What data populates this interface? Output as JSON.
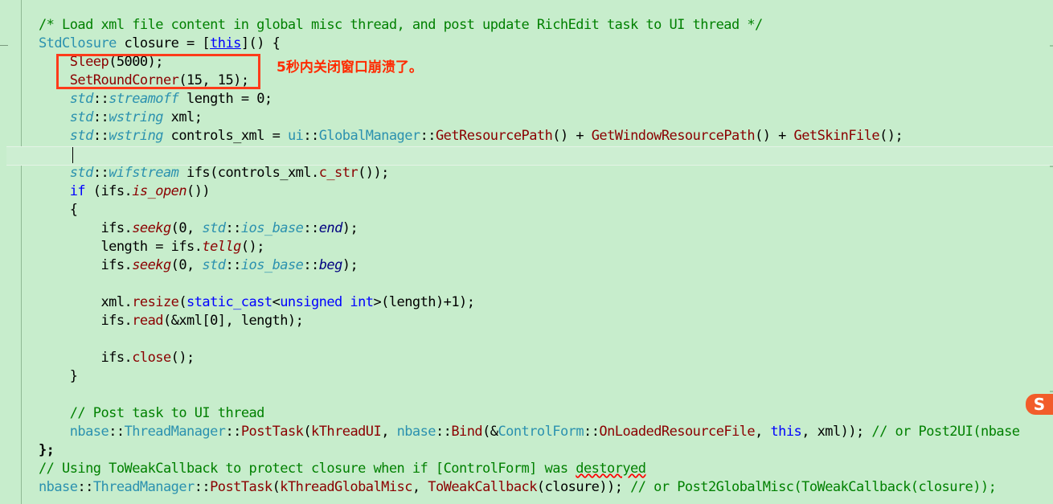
{
  "annotation": {
    "text": "5秒内关闭窗口崩溃了。",
    "color": "#ff2a00",
    "box_color": "#ff3b1a"
  },
  "editor": {
    "background": "#c7edcc",
    "lines": [
      "/* Load xml file content in global misc thread, and post update RichEdit task to UI thread */",
      "StdClosure closure = [this]() {",
      "Sleep(5000);",
      "SetRoundCorner(15, 15);",
      "std::streamoff length = 0;",
      "std::wstring xml;",
      "std::wstring controls_xml = ui::GlobalManager::GetResourcePath() + GetWindowResourcePath() + GetSkinFile();",
      "",
      "std::wifstream ifs(controls_xml.c_str());",
      "if (ifs.is_open())",
      "{",
      "ifs.seekg(0, std::ios_base::end);",
      "length = ifs.tellg();",
      "ifs.seekg(0, std::ios_base::beg);",
      "",
      "xml.resize(static_cast<unsigned int>(length)+1);",
      "ifs.read(&xml[0], length);",
      "",
      "ifs.close();",
      "}",
      "",
      "// Post task to UI thread",
      "nbase::ThreadManager::PostTask(kThreadUI, nbase::Bind(&ControlForm::OnLoadedResourceFile, this, xml)); // or Post2UI(nbase",
      "};",
      "// Using ToWeakCallback to protect closure when if [ControlForm] was destoryed",
      "nbase::ThreadManager::PostTask(kThreadGlobalMisc, ToWeakCallback(closure)); // or Post2GlobalMisc(ToWeakCallback(closure));"
    ]
  },
  "tray": {
    "icon": "sogou-ime-icon",
    "label": "S"
  }
}
